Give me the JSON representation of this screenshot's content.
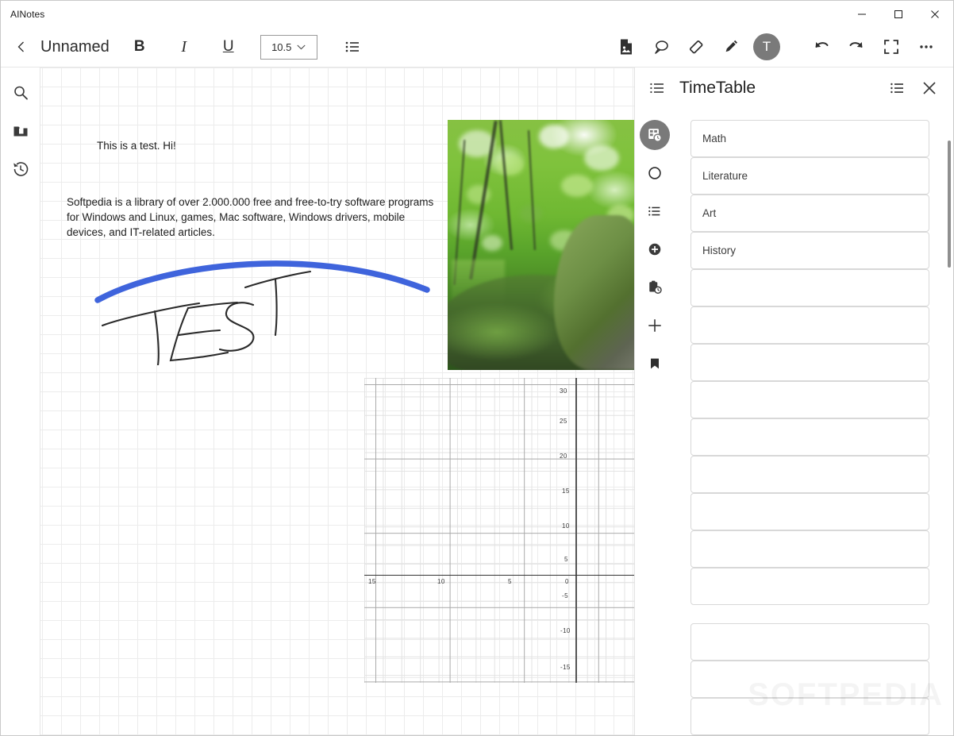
{
  "window": {
    "app_title": "AINotes",
    "controls": [
      {
        "name": "minimize",
        "glyph": "minimize-icon"
      },
      {
        "name": "maximize",
        "glyph": "maximize-icon"
      },
      {
        "name": "close",
        "glyph": "close-icon"
      }
    ]
  },
  "toolbar": {
    "back_icon": "chevron-left-icon",
    "document_title": "Unnamed",
    "bold_label": "B",
    "italic_label": "I",
    "underline_label": "U",
    "font_size": "10.5",
    "font_size_chevron": "chevron-down-icon",
    "list_icon": "bullet-list-icon",
    "right_tools": [
      {
        "name": "insert-image",
        "icon": "image-file-icon"
      },
      {
        "name": "comment",
        "icon": "speech-bubble-icon"
      },
      {
        "name": "eraser",
        "icon": "eraser-icon"
      },
      {
        "name": "pen",
        "icon": "pen-icon"
      },
      {
        "name": "text-tool",
        "icon": "text-avatar",
        "label": "T"
      },
      {
        "name": "undo",
        "icon": "undo-icon"
      },
      {
        "name": "redo",
        "icon": "redo-icon"
      },
      {
        "name": "fullscreen",
        "icon": "fullscreen-icon"
      },
      {
        "name": "more-options",
        "icon": "ellipsis-icon"
      }
    ]
  },
  "left_rail": [
    {
      "name": "search",
      "icon": "search-icon"
    },
    {
      "name": "files",
      "icon": "folder-file-icon"
    },
    {
      "name": "history",
      "icon": "history-clock-icon"
    }
  ],
  "canvas": {
    "line1": "This is a test. Hi!",
    "paragraph": "Softpedia is a library of over 2.000.000 free and free-to-try software programs for Windows and Linux, games, Mac software, Windows drivers, mobile devices, and IT-related articles.",
    "handwriting": "TEST",
    "stroke_color": "#3f64dc",
    "image_alt": "forest-photo"
  },
  "chart_data": {
    "type": "scatter",
    "title": "",
    "xlabel": "",
    "ylabel": "",
    "x_ticks": [
      "15",
      "10",
      "5",
      "0"
    ],
    "y_ticks": [
      "30",
      "25",
      "20",
      "15",
      "10",
      "5",
      "-5",
      "-10",
      "-15"
    ],
    "xlim": [
      -17,
      3
    ],
    "ylim": [
      -18,
      32
    ],
    "grid": true,
    "legend": "none",
    "series": []
  },
  "panel": {
    "header_icon": "ordered-list-icon",
    "title": "TimeTable",
    "menu_icon": "bullet-list-icon",
    "close_icon": "close-icon",
    "scroll_thumb": true,
    "vertical_rail": [
      {
        "name": "timetable",
        "icon": "timetable-clock-icon",
        "active": true
      },
      {
        "name": "circle",
        "icon": "circle-outline-icon",
        "active": false
      },
      {
        "name": "list",
        "icon": "bullet-list-icon",
        "active": false
      },
      {
        "name": "add-circle",
        "icon": "plus-circle-icon",
        "active": false
      },
      {
        "name": "clipboard-clock",
        "icon": "clipboard-clock-icon",
        "active": false
      },
      {
        "name": "add",
        "icon": "plus-icon",
        "active": false
      },
      {
        "name": "bookmark",
        "icon": "bookmark-icon",
        "active": false
      }
    ],
    "slots_group_1": [
      {
        "label": "Math"
      },
      {
        "label": "Literature"
      },
      {
        "label": "Art"
      },
      {
        "label": "History"
      },
      {
        "label": ""
      },
      {
        "label": ""
      },
      {
        "label": ""
      },
      {
        "label": ""
      },
      {
        "label": ""
      },
      {
        "label": ""
      },
      {
        "label": ""
      },
      {
        "label": ""
      },
      {
        "label": ""
      }
    ],
    "slots_group_2": [
      {
        "label": ""
      },
      {
        "label": ""
      },
      {
        "label": ""
      }
    ]
  },
  "watermark": "SOFTPEDIA"
}
